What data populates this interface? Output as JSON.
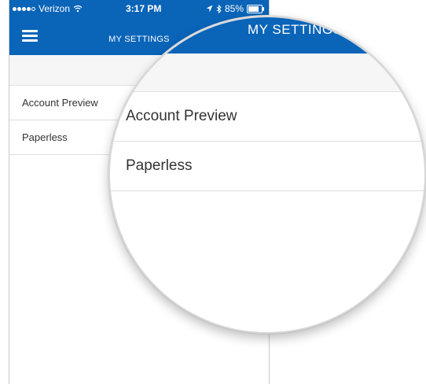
{
  "status_bar": {
    "carrier": "Verizon",
    "time": "3:17 PM",
    "battery": "85%"
  },
  "header": {
    "title": "MY SETTINGS"
  },
  "menu": {
    "items": [
      {
        "label": "Account Preview"
      },
      {
        "label": "Paperless"
      }
    ]
  },
  "magnifier": {
    "title": "MY SETTINGS",
    "items": [
      {
        "label": "Account Preview"
      },
      {
        "label": "Paperless"
      }
    ]
  },
  "colors": {
    "brand_blue": "#0a64b8"
  }
}
